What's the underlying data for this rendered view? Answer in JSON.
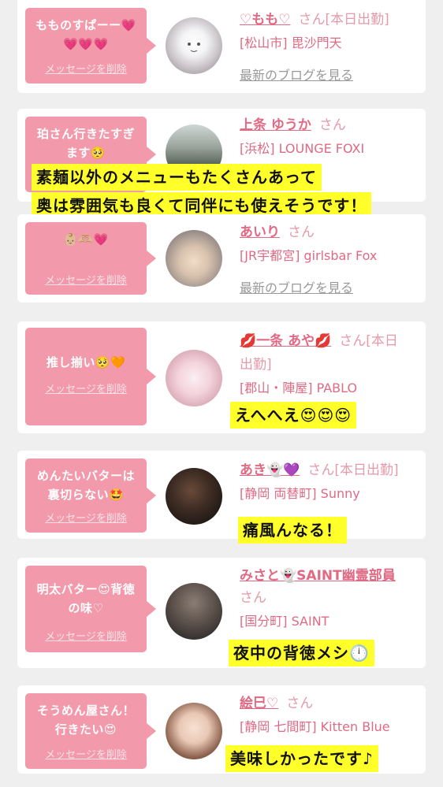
{
  "colors": {
    "bubble": "#f29aab",
    "name": "#e06a84",
    "caption_bg": "#ffff2a",
    "background": "#efefef"
  },
  "common": {
    "delete_label": "メッセージを削除",
    "blog_label": "最新のブログを見る",
    "san": "さん"
  },
  "cards": [
    {
      "msg_l1": "もものすぱーー💗",
      "msg_l2": "💗💗💗",
      "name": "♡もも♡",
      "today": "[本日出勤]",
      "shop": "[松山市] 毘沙門天",
      "blog": "最新のブログを見る"
    },
    {
      "msg_l1": "珀さん行きたすぎ",
      "msg_l2": "ます🥺",
      "name": "上条 ゆうか",
      "shop": "[浜松] LOUNGE FOXI",
      "caption_l1": "素麺以外のメニューもたくさんあって",
      "caption_l2": "奥は雰囲気も良くて同伴にも使えそうです！"
    },
    {
      "msg_l1": "👶🏼🫶🏼💗",
      "name": "あいり",
      "shop": "[JR宇都宮] girlsbar Fox",
      "blog": "最新のブログを見る"
    },
    {
      "msg_l1": "推し揃い🥺🧡",
      "name": "💋一条 あや💋",
      "name_suffix": "さん[本日",
      "name_l2": "出勤]",
      "shop": "[郡山・陣屋] PABLO",
      "caption": "えへへえ😍😍😍"
    },
    {
      "msg_l1": "めんたいバターは",
      "msg_l2": "裏切らない🤩",
      "name": "あき👻💜",
      "today": "[本日出勤]",
      "shop": "[静岡 両替町] Sunny",
      "caption": "痛風んなる！"
    },
    {
      "msg_l1": "明太バター😍背徳",
      "msg_l2": "の味♡",
      "name": "みさと👻SAINT幽霊部員",
      "name_l2": "さん",
      "shop": "[国分町] SAINT",
      "caption": "夜中の背徳メシ🕛"
    },
    {
      "msg_l1": "そうめん屋さん！",
      "msg_l2": "行きたい😍",
      "name": "絵巳♡",
      "shop": "[静岡 七間町] Kitten Blue",
      "caption": "美味しかったです♪"
    }
  ]
}
